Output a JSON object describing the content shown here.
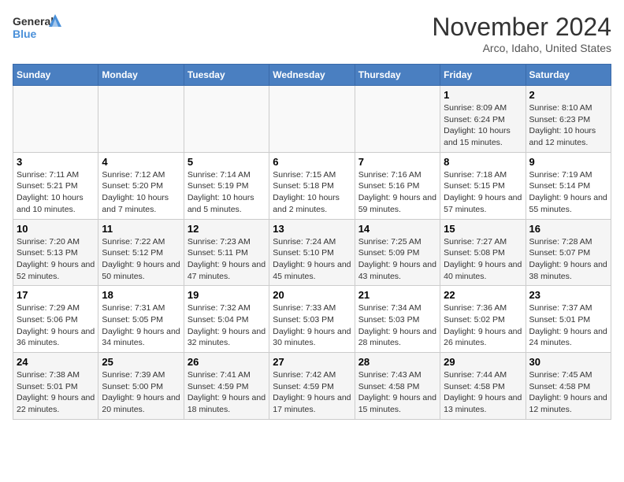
{
  "header": {
    "logo_line1": "General",
    "logo_line2": "Blue",
    "month": "November 2024",
    "location": "Arco, Idaho, United States"
  },
  "weekdays": [
    "Sunday",
    "Monday",
    "Tuesday",
    "Wednesday",
    "Thursday",
    "Friday",
    "Saturday"
  ],
  "weeks": [
    [
      {
        "day": "",
        "info": ""
      },
      {
        "day": "",
        "info": ""
      },
      {
        "day": "",
        "info": ""
      },
      {
        "day": "",
        "info": ""
      },
      {
        "day": "",
        "info": ""
      },
      {
        "day": "1",
        "info": "Sunrise: 8:09 AM\nSunset: 6:24 PM\nDaylight: 10 hours and 15 minutes."
      },
      {
        "day": "2",
        "info": "Sunrise: 8:10 AM\nSunset: 6:23 PM\nDaylight: 10 hours and 12 minutes."
      }
    ],
    [
      {
        "day": "3",
        "info": "Sunrise: 7:11 AM\nSunset: 5:21 PM\nDaylight: 10 hours and 10 minutes."
      },
      {
        "day": "4",
        "info": "Sunrise: 7:12 AM\nSunset: 5:20 PM\nDaylight: 10 hours and 7 minutes."
      },
      {
        "day": "5",
        "info": "Sunrise: 7:14 AM\nSunset: 5:19 PM\nDaylight: 10 hours and 5 minutes."
      },
      {
        "day": "6",
        "info": "Sunrise: 7:15 AM\nSunset: 5:18 PM\nDaylight: 10 hours and 2 minutes."
      },
      {
        "day": "7",
        "info": "Sunrise: 7:16 AM\nSunset: 5:16 PM\nDaylight: 9 hours and 59 minutes."
      },
      {
        "day": "8",
        "info": "Sunrise: 7:18 AM\nSunset: 5:15 PM\nDaylight: 9 hours and 57 minutes."
      },
      {
        "day": "9",
        "info": "Sunrise: 7:19 AM\nSunset: 5:14 PM\nDaylight: 9 hours and 55 minutes."
      }
    ],
    [
      {
        "day": "10",
        "info": "Sunrise: 7:20 AM\nSunset: 5:13 PM\nDaylight: 9 hours and 52 minutes."
      },
      {
        "day": "11",
        "info": "Sunrise: 7:22 AM\nSunset: 5:12 PM\nDaylight: 9 hours and 50 minutes."
      },
      {
        "day": "12",
        "info": "Sunrise: 7:23 AM\nSunset: 5:11 PM\nDaylight: 9 hours and 47 minutes."
      },
      {
        "day": "13",
        "info": "Sunrise: 7:24 AM\nSunset: 5:10 PM\nDaylight: 9 hours and 45 minutes."
      },
      {
        "day": "14",
        "info": "Sunrise: 7:25 AM\nSunset: 5:09 PM\nDaylight: 9 hours and 43 minutes."
      },
      {
        "day": "15",
        "info": "Sunrise: 7:27 AM\nSunset: 5:08 PM\nDaylight: 9 hours and 40 minutes."
      },
      {
        "day": "16",
        "info": "Sunrise: 7:28 AM\nSunset: 5:07 PM\nDaylight: 9 hours and 38 minutes."
      }
    ],
    [
      {
        "day": "17",
        "info": "Sunrise: 7:29 AM\nSunset: 5:06 PM\nDaylight: 9 hours and 36 minutes."
      },
      {
        "day": "18",
        "info": "Sunrise: 7:31 AM\nSunset: 5:05 PM\nDaylight: 9 hours and 34 minutes."
      },
      {
        "day": "19",
        "info": "Sunrise: 7:32 AM\nSunset: 5:04 PM\nDaylight: 9 hours and 32 minutes."
      },
      {
        "day": "20",
        "info": "Sunrise: 7:33 AM\nSunset: 5:03 PM\nDaylight: 9 hours and 30 minutes."
      },
      {
        "day": "21",
        "info": "Sunrise: 7:34 AM\nSunset: 5:03 PM\nDaylight: 9 hours and 28 minutes."
      },
      {
        "day": "22",
        "info": "Sunrise: 7:36 AM\nSunset: 5:02 PM\nDaylight: 9 hours and 26 minutes."
      },
      {
        "day": "23",
        "info": "Sunrise: 7:37 AM\nSunset: 5:01 PM\nDaylight: 9 hours and 24 minutes."
      }
    ],
    [
      {
        "day": "24",
        "info": "Sunrise: 7:38 AM\nSunset: 5:01 PM\nDaylight: 9 hours and 22 minutes."
      },
      {
        "day": "25",
        "info": "Sunrise: 7:39 AM\nSunset: 5:00 PM\nDaylight: 9 hours and 20 minutes."
      },
      {
        "day": "26",
        "info": "Sunrise: 7:41 AM\nSunset: 4:59 PM\nDaylight: 9 hours and 18 minutes."
      },
      {
        "day": "27",
        "info": "Sunrise: 7:42 AM\nSunset: 4:59 PM\nDaylight: 9 hours and 17 minutes."
      },
      {
        "day": "28",
        "info": "Sunrise: 7:43 AM\nSunset: 4:58 PM\nDaylight: 9 hours and 15 minutes."
      },
      {
        "day": "29",
        "info": "Sunrise: 7:44 AM\nSunset: 4:58 PM\nDaylight: 9 hours and 13 minutes."
      },
      {
        "day": "30",
        "info": "Sunrise: 7:45 AM\nSunset: 4:58 PM\nDaylight: 9 hours and 12 minutes."
      }
    ]
  ]
}
